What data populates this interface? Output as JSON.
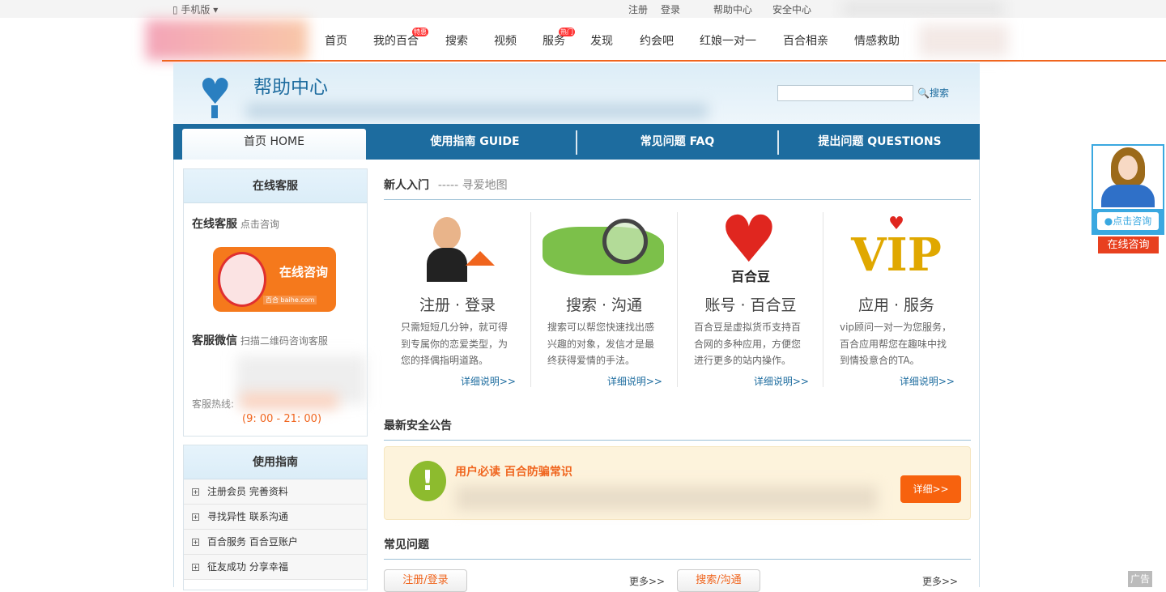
{
  "topbar": {
    "mobile": "手机版",
    "register": "注册",
    "login": "登录",
    "help": "帮助中心",
    "security": "安全中心"
  },
  "nav": {
    "items": [
      "首页",
      "我的百合",
      "搜索",
      "视频",
      "服务",
      "发现",
      "约会吧",
      "红娘一对一",
      "百合相亲",
      "情感救助"
    ],
    "badge_mybaihe": "特惠",
    "badge_service": "热门"
  },
  "help_header": {
    "title": "帮助中心",
    "search_placeholder": "",
    "search_label": "搜索"
  },
  "tabs": [
    {
      "label": "首页 HOME",
      "active": true
    },
    {
      "label": "使用指南 GUIDE"
    },
    {
      "label": "常见问题 FAQ"
    },
    {
      "label": "提出问题 QUESTIONS"
    }
  ],
  "sidebar": {
    "service_title": "在线客服",
    "online_label": "在线客服",
    "online_hint": "点击咨询",
    "online_btn": "在线咨询",
    "online_logo": "百合 baihe.com",
    "wechat_label": "客服微信",
    "wechat_hint": "扫描二维码咨询客服",
    "hotline_label": "客服热线:",
    "hours": "(9: 00 - 21: 00)",
    "guide_title": "使用指南",
    "guide_items": [
      "注册会员 完善资料",
      "寻找异性 联系沟通",
      "百合服务 百合豆账户",
      "征友成功 分享幸福"
    ]
  },
  "main": {
    "intro_title": "新人入门",
    "intro_sub": "----- 寻爱地图",
    "cards": [
      {
        "title": "注册 · 登录",
        "desc": "只需短短几分钟，就可得到专属你的恋爱类型，为您的择偶指明道路。",
        "link": "详细说明>>"
      },
      {
        "title": "搜索 · 沟通",
        "desc": "搜索可以帮您快速找出感兴趣的对象，发信才是最终获得爱情的手法。",
        "link": "详细说明>>"
      },
      {
        "title": "账号 · 百合豆",
        "desc": "百合豆是虚拟货币支持百合网的多种应用，方便您进行更多的站内操作。",
        "link": "详细说明>>",
        "icon_text": "百合豆"
      },
      {
        "title": "应用 · 服务",
        "desc": "vip顾问一对一为您服务，百合应用帮您在趣味中找到情投意合的TA。",
        "link": "详细说明>>",
        "icon_text": "VIP"
      }
    ],
    "security_title": "最新安全公告",
    "notice_title": "用户必读 百合防骗常识",
    "notice_btn": "详细>>",
    "faq_title": "常见问题",
    "faq": [
      {
        "label": "注册/登录",
        "more": "更多>>"
      },
      {
        "label": "搜索/沟通",
        "more": "更多>>"
      }
    ]
  },
  "float": {
    "click": "点击咨询",
    "online": "在线咨询"
  },
  "ad": "广告",
  "colors": {
    "accent": "#f0651e",
    "brand_blue": "#1d6c9f"
  }
}
